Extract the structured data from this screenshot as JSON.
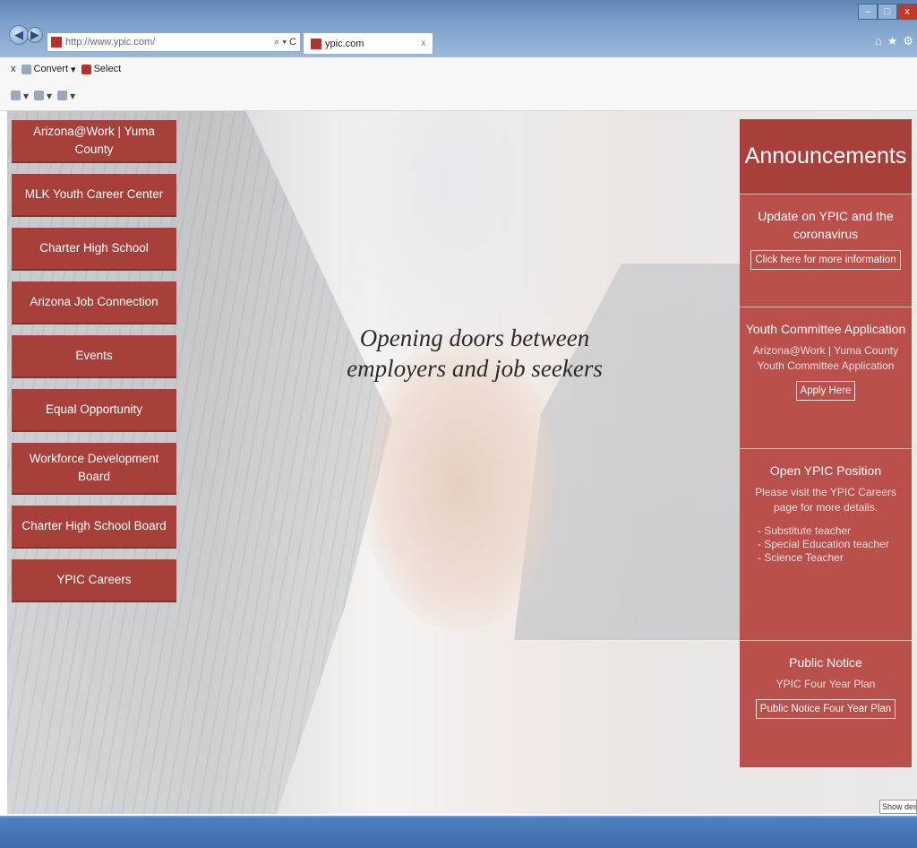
{
  "browser": {
    "address": "http://www.ypic.com/",
    "address_tools": "⌕ ▾ C",
    "tab_title": "ypic.com",
    "tab_close": "x",
    "window_controls": [
      "–",
      "□",
      "x"
    ],
    "chrome_icons": [
      "⌂",
      "★",
      "⚙"
    ],
    "toolbar": {
      "close": "x",
      "convert": "Convert",
      "select": "Select"
    }
  },
  "sidebar": {
    "items": [
      {
        "label": "Arizona@Work | Yuma County"
      },
      {
        "label": "MLK Youth Career Center"
      },
      {
        "label": "Charter High School"
      },
      {
        "label": "Arizona Job Connection"
      },
      {
        "label": "Events"
      },
      {
        "label": "Equal Opportunity"
      },
      {
        "label": "Workforce Development Board"
      },
      {
        "label": "Charter High School Board"
      },
      {
        "label": "YPIC Careers"
      }
    ]
  },
  "hero": {
    "tagline_line1": "Opening doors between",
    "tagline_line2": "employers and job seekers"
  },
  "announcements": {
    "heading": "Announcements",
    "blocks": [
      {
        "title": "Update on YPIC and the coronavirus",
        "button": "Click here for more information"
      },
      {
        "title": "Youth Committee Application",
        "text": "Arizona@Work | Yuma County Youth Committee Application",
        "button": "Apply Here"
      },
      {
        "title": "Open YPIC Position",
        "text": "Please visit the YPIC Careers page for more details.",
        "list": [
          "- Substitute teacher",
          "- Special Education teacher",
          "- Science Teacher"
        ]
      },
      {
        "title": "Public Notice",
        "text": "YPIC Four Year Plan",
        "button": "Public Notice Four Year Plan"
      }
    ]
  },
  "show_desktop": "Show desktop",
  "colors": {
    "brand": "#a7403b",
    "panel": "#b9504b",
    "taskbar": "#3f6dae"
  }
}
